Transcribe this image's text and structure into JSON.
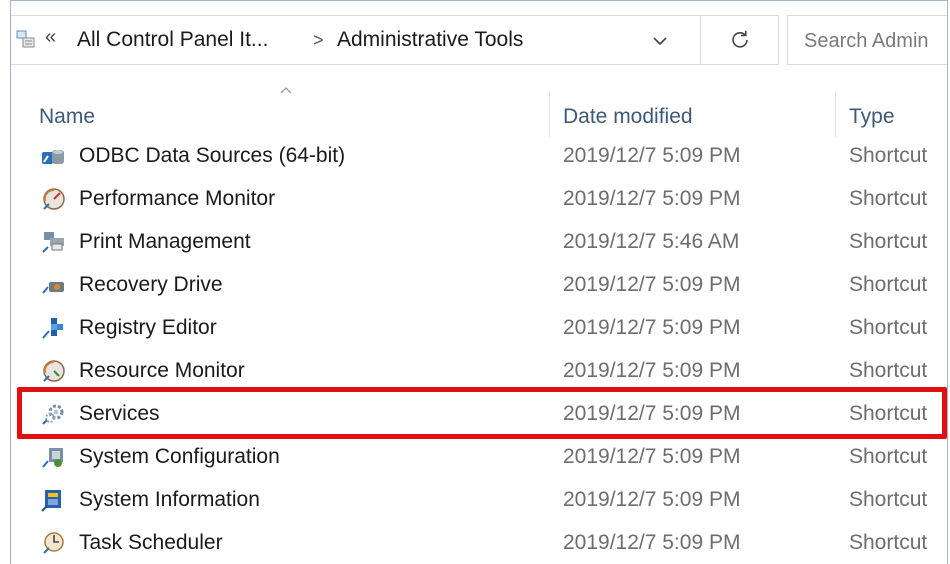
{
  "address": {
    "overflow_glyph": "«",
    "crumbs": [
      "All Control Panel It...",
      "Administrative Tools"
    ],
    "separator": ">"
  },
  "search": {
    "placeholder": "Search Admin"
  },
  "columns": {
    "name": "Name",
    "date": "Date modified",
    "type": "Type"
  },
  "rows": [
    {
      "name": "ODBC Data Sources (64-bit)",
      "date": "2019/12/7 5:09 PM",
      "type": "Shortcut",
      "icon": "odbc-icon"
    },
    {
      "name": "Performance Monitor",
      "date": "2019/12/7 5:09 PM",
      "type": "Shortcut",
      "icon": "performance-monitor-icon"
    },
    {
      "name": "Print Management",
      "date": "2019/12/7 5:46 AM",
      "type": "Shortcut",
      "icon": "print-management-icon"
    },
    {
      "name": "Recovery Drive",
      "date": "2019/12/7 5:09 PM",
      "type": "Shortcut",
      "icon": "recovery-drive-icon"
    },
    {
      "name": "Registry Editor",
      "date": "2019/12/7 5:09 PM",
      "type": "Shortcut",
      "icon": "registry-editor-icon"
    },
    {
      "name": "Resource Monitor",
      "date": "2019/12/7 5:09 PM",
      "type": "Shortcut",
      "icon": "resource-monitor-icon"
    },
    {
      "name": "Services",
      "date": "2019/12/7 5:09 PM",
      "type": "Shortcut",
      "icon": "services-icon"
    },
    {
      "name": "System Configuration",
      "date": "2019/12/7 5:09 PM",
      "type": "Shortcut",
      "icon": "system-configuration-icon"
    },
    {
      "name": "System Information",
      "date": "2019/12/7 5:09 PM",
      "type": "Shortcut",
      "icon": "system-information-icon"
    },
    {
      "name": "Task Scheduler",
      "date": "2019/12/7 5:09 PM",
      "type": "Shortcut",
      "icon": "task-scheduler-icon"
    }
  ],
  "highlighted_row": "Services",
  "colors": {
    "highlight": "#e01010",
    "header_text": "#3c5a78",
    "muted_text": "#6d6d6d"
  }
}
